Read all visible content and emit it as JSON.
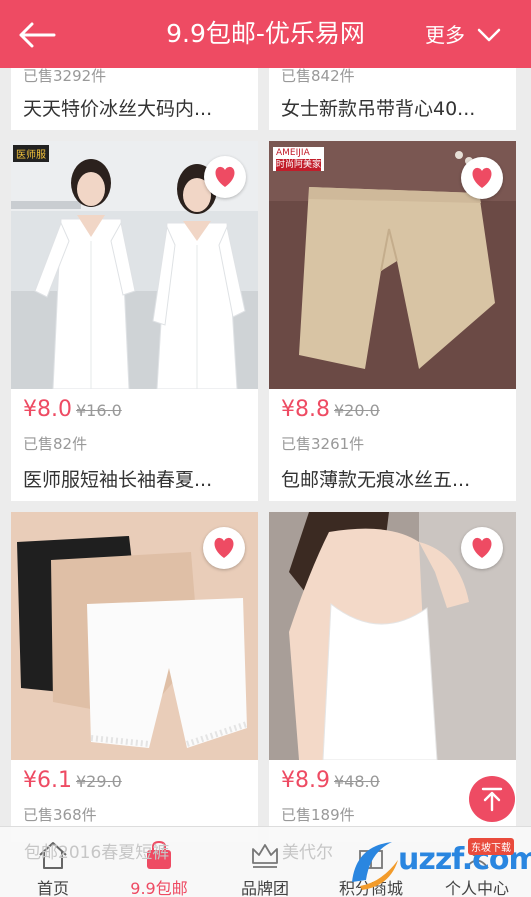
{
  "header": {
    "title": "9.9包邮-优乐易网",
    "more_label": "更多"
  },
  "top_row": [
    {
      "sold": "已售3292件",
      "name": "天天特价冰丝大码内..."
    },
    {
      "sold": "已售842件",
      "name": "女士新款吊带背心40..."
    }
  ],
  "products": [
    {
      "price": "¥8.0",
      "orig_price": "¥16.0",
      "sold": "已售82件",
      "name": "医师服短袖长袖春夏...",
      "store_badge": "医师服"
    },
    {
      "price": "¥8.8",
      "orig_price": "¥20.0",
      "sold": "已售3261件",
      "name": "包邮薄款无痕冰丝五...",
      "store_badge": "AMEIJIA",
      "store_sub": "时尚阿美家"
    },
    {
      "price": "¥6.1",
      "orig_price": "¥29.0",
      "sold": "已售368件",
      "name": ""
    },
    {
      "price": "¥8.9",
      "orig_price": "¥48.0",
      "sold": "已售189件",
      "name": ""
    }
  ],
  "ghost_text": {
    "left": "包邮2016春夏短裤",
    "right": "美代尔"
  },
  "tabs": [
    {
      "label": "首页",
      "icon": "home-icon"
    },
    {
      "label": "9.9包邮",
      "icon": "bag-icon"
    },
    {
      "label": "品牌团",
      "icon": "crown-icon"
    },
    {
      "label": "积分商城",
      "icon": "gift-icon"
    },
    {
      "label": "个人中心",
      "icon": "user-icon"
    }
  ],
  "watermark": {
    "text": "uzzf.com",
    "sub": "东坡下载"
  },
  "colors": {
    "accent": "#ee4b63",
    "background": "#ececec"
  }
}
